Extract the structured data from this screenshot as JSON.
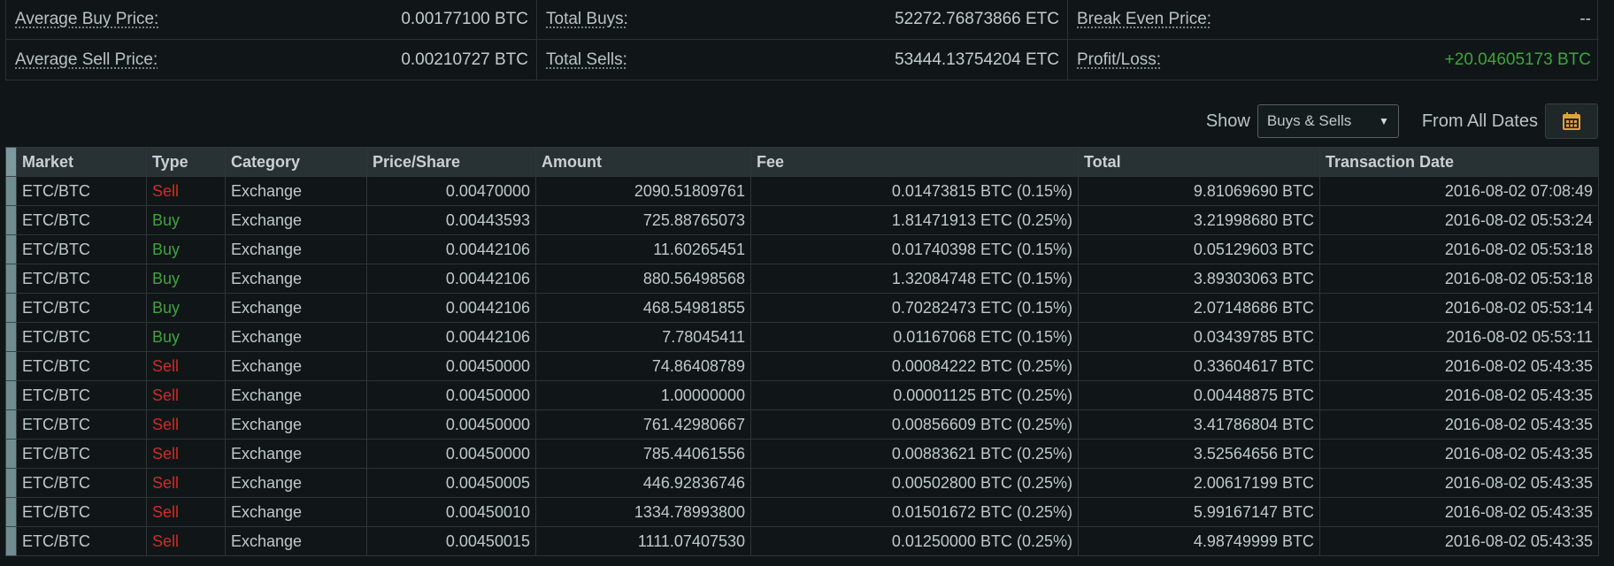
{
  "summary": {
    "avg_buy_price_label": "Average Buy Price:",
    "avg_buy_price": "0.00177100 BTC",
    "total_buys_label": "Total Buys:",
    "total_buys": "52272.76873866 ETC",
    "break_even_label": "Break Even Price:",
    "break_even": "--",
    "avg_sell_price_label": "Average Sell Price:",
    "avg_sell_price": "0.00210727 BTC",
    "total_sells_label": "Total Sells:",
    "total_sells": "53444.13754204 ETC",
    "profit_loss_label": "Profit/Loss:",
    "profit_loss": "+20.04605173 BTC"
  },
  "toolbar": {
    "show_label": "Show",
    "show_selected": "Buys & Sells",
    "dates_label": "From All Dates",
    "calendar_icon": "calendar-icon"
  },
  "colors": {
    "sell": "#d02a2a",
    "buy": "#3fa33f",
    "profit": "#3fa33f",
    "calendar": "#e2a23a"
  },
  "table": {
    "headers": {
      "market": "Market",
      "type": "Type",
      "category": "Category",
      "price": "Price/Share",
      "amount": "Amount",
      "fee": "Fee",
      "total": "Total",
      "date": "Transaction Date"
    },
    "rows": [
      {
        "market": "ETC/BTC",
        "type": "Sell",
        "category": "Exchange",
        "price": "0.00470000",
        "amount": "2090.51809761",
        "fee": "0.01473815 BTC (0.15%)",
        "total": "9.81069690 BTC",
        "date": "2016-08-02 07:08:49"
      },
      {
        "market": "ETC/BTC",
        "type": "Buy",
        "category": "Exchange",
        "price": "0.00443593",
        "amount": "725.88765073",
        "fee": "1.81471913 ETC (0.25%)",
        "total": "3.21998680 BTC",
        "date": "2016-08-02 05:53:24"
      },
      {
        "market": "ETC/BTC",
        "type": "Buy",
        "category": "Exchange",
        "price": "0.00442106",
        "amount": "11.60265451",
        "fee": "0.01740398 ETC (0.15%)",
        "total": "0.05129603 BTC",
        "date": "2016-08-02 05:53:18"
      },
      {
        "market": "ETC/BTC",
        "type": "Buy",
        "category": "Exchange",
        "price": "0.00442106",
        "amount": "880.56498568",
        "fee": "1.32084748 ETC (0.15%)",
        "total": "3.89303063 BTC",
        "date": "2016-08-02 05:53:18"
      },
      {
        "market": "ETC/BTC",
        "type": "Buy",
        "category": "Exchange",
        "price": "0.00442106",
        "amount": "468.54981855",
        "fee": "0.70282473 ETC (0.15%)",
        "total": "2.07148686 BTC",
        "date": "2016-08-02 05:53:14"
      },
      {
        "market": "ETC/BTC",
        "type": "Buy",
        "category": "Exchange",
        "price": "0.00442106",
        "amount": "7.78045411",
        "fee": "0.01167068 ETC (0.15%)",
        "total": "0.03439785 BTC",
        "date": "2016-08-02 05:53:11"
      },
      {
        "market": "ETC/BTC",
        "type": "Sell",
        "category": "Exchange",
        "price": "0.00450000",
        "amount": "74.86408789",
        "fee": "0.00084222 BTC (0.25%)",
        "total": "0.33604617 BTC",
        "date": "2016-08-02 05:43:35"
      },
      {
        "market": "ETC/BTC",
        "type": "Sell",
        "category": "Exchange",
        "price": "0.00450000",
        "amount": "1.00000000",
        "fee": "0.00001125 BTC (0.25%)",
        "total": "0.00448875 BTC",
        "date": "2016-08-02 05:43:35"
      },
      {
        "market": "ETC/BTC",
        "type": "Sell",
        "category": "Exchange",
        "price": "0.00450000",
        "amount": "761.42980667",
        "fee": "0.00856609 BTC (0.25%)",
        "total": "3.41786804 BTC",
        "date": "2016-08-02 05:43:35"
      },
      {
        "market": "ETC/BTC",
        "type": "Sell",
        "category": "Exchange",
        "price": "0.00450000",
        "amount": "785.44061556",
        "fee": "0.00883621 BTC (0.25%)",
        "total": "3.52564656 BTC",
        "date": "2016-08-02 05:43:35"
      },
      {
        "market": "ETC/BTC",
        "type": "Sell",
        "category": "Exchange",
        "price": "0.00450005",
        "amount": "446.92836746",
        "fee": "0.00502800 BTC (0.25%)",
        "total": "2.00617199 BTC",
        "date": "2016-08-02 05:43:35"
      },
      {
        "market": "ETC/BTC",
        "type": "Sell",
        "category": "Exchange",
        "price": "0.00450010",
        "amount": "1334.78993800",
        "fee": "0.01501672 BTC (0.25%)",
        "total": "5.99167147 BTC",
        "date": "2016-08-02 05:43:35"
      },
      {
        "market": "ETC/BTC",
        "type": "Sell",
        "category": "Exchange",
        "price": "0.00450015",
        "amount": "1111.07407530",
        "fee": "0.01250000 BTC (0.25%)",
        "total": "4.98749999 BTC",
        "date": "2016-08-02 05:43:35"
      }
    ]
  }
}
